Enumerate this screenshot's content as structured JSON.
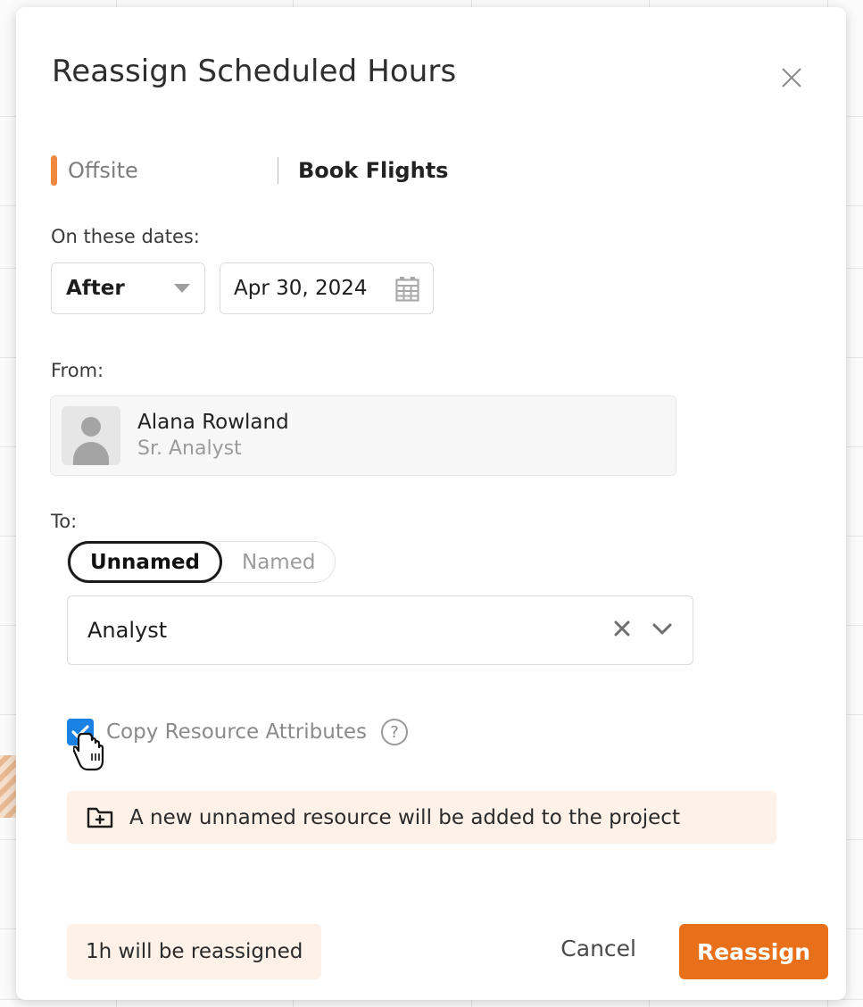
{
  "dialog": {
    "title": "Reassign Scheduled Hours",
    "close_icon": "close-icon"
  },
  "context": {
    "project": "Offsite",
    "task": "Book Flights",
    "accent_color": "#f0883e"
  },
  "dates": {
    "label": "On these dates:",
    "operator": "After",
    "operator_icon": "chevron-down-icon",
    "date_value": "Apr 30, 2024",
    "date_icon": "calendar-icon"
  },
  "from": {
    "label": "From:",
    "name": "Alana Rowland",
    "role": "Sr. Analyst",
    "avatar_icon": "user-avatar-icon"
  },
  "to": {
    "label": "To:",
    "toggle": [
      {
        "label": "Unnamed",
        "selected": true
      },
      {
        "label": "Named",
        "selected": false
      }
    ],
    "role_value": "Analyst",
    "clear_icon": "close-icon",
    "expand_icon": "chevron-down-icon"
  },
  "options": {
    "copy_attributes_label": "Copy Resource Attributes",
    "copy_attributes_checked": true,
    "help_icon": "question-circle-icon",
    "checkbox_color": "#1a82e2"
  },
  "notice": {
    "icon": "folder-plus-icon",
    "text": "A new unnamed resource will be added to the project"
  },
  "footer": {
    "summary": "1h will be reassigned",
    "cancel_label": "Cancel",
    "confirm_label": "Reassign",
    "confirm_color": "#e8701a"
  }
}
